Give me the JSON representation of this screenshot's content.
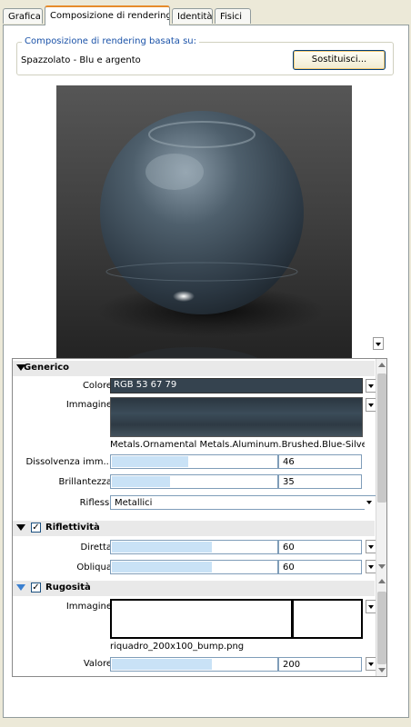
{
  "tabs": [
    "Grafica",
    "Composizione di rendering",
    "Identità",
    "Fisici"
  ],
  "composition": {
    "legend": "Composizione di rendering basata su:",
    "value": "Spazzolato - Blu e argento",
    "replace_button": "Sostituisci..."
  },
  "generico": {
    "header": "Generico",
    "color_label": "Colore",
    "color_value": "RGB 53 67 79",
    "color_hex": "#35434f",
    "image_label": "Immagine",
    "image_name": "Metals.Ornamental Metals.Aluminum.Brushed.Blue-Silve...",
    "fade_label": "Dissolvenza imm...",
    "fade_value": "46",
    "fade_level": 46,
    "gloss_label": "Brillantezza",
    "gloss_value": "35",
    "gloss_level": 35,
    "highlights_label": "Riflessi",
    "highlights_value": "Metallici"
  },
  "riflettivita": {
    "header": "Riflettività",
    "direct_label": "Diretta",
    "direct_value": "60",
    "direct_level": 60,
    "oblique_label": "Obliqua",
    "oblique_value": "60",
    "oblique_level": 60
  },
  "rugosita": {
    "header": "Rugosità",
    "image_label": "Immagine",
    "image_name": "riquadro_200x100_bump.png",
    "value_label": "Valore",
    "value_value": "200",
    "value_level": 60
  }
}
